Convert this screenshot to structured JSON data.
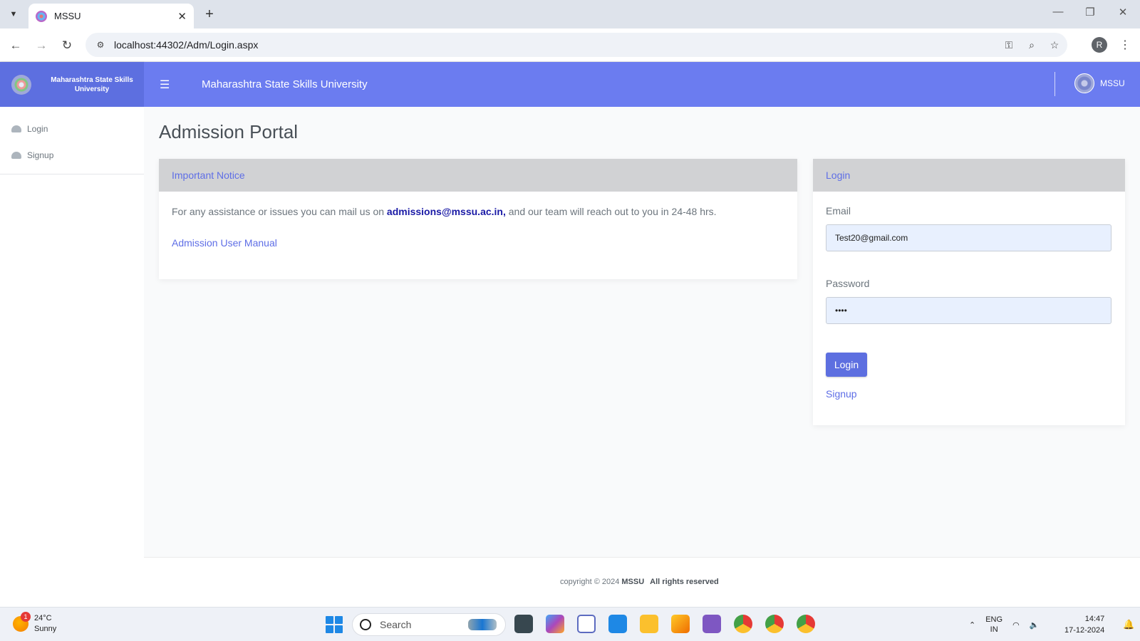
{
  "browser": {
    "tab_title": "MSSU",
    "url": "localhost:44302/Adm/Login.aspx",
    "profile_initial": "R"
  },
  "sidebar": {
    "brand": "Maharashtra State Skills University",
    "items": [
      {
        "label": "Login",
        "icon": "dashboard-icon"
      },
      {
        "label": "Signup",
        "icon": "dashboard-icon"
      }
    ]
  },
  "header": {
    "title": "Maharashtra State Skills University",
    "user_name": "MSSU"
  },
  "main": {
    "page_title": "Admission Portal",
    "notice": {
      "header": "Important Notice",
      "text_before": "For any assistance or issues you can mail us on ",
      "email": "admissions@mssu.ac.in,",
      "text_after": " and our team will reach out to you in 24-48 hrs.",
      "manual_link": "Admission User Manual"
    },
    "login": {
      "header": "Login",
      "email_label": "Email",
      "email_value": "Test20@gmail.com",
      "password_label": "Password",
      "password_value": "••••",
      "button": "Login",
      "signup_link": "Signup"
    }
  },
  "footer": {
    "copyright": "copyright © 2024 ",
    "brand": "MSSU",
    "rights": "All rights reserved"
  },
  "taskbar": {
    "weather_temp": "24°C",
    "weather_desc": "Sunny",
    "weather_badge": "1",
    "search_label": "Search",
    "lang_line1": "ENG",
    "lang_line2": "IN",
    "time": "14:47",
    "date": "17-12-2024"
  },
  "colors": {
    "header_blue": "#6b7cf0",
    "brand_blue": "#5d6fe0",
    "link_blue": "#5e6ee6",
    "email_blue": "#1a1aa6"
  }
}
